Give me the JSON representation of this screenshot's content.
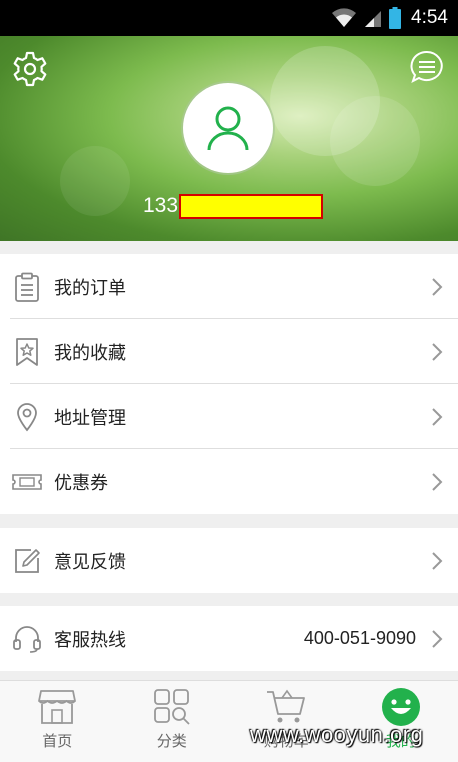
{
  "status_bar": {
    "time": "4:54"
  },
  "profile": {
    "phone_prefix": "133"
  },
  "menu": {
    "orders": "我的订单",
    "favorites": "我的收藏",
    "address": "地址管理",
    "coupons": "优惠券",
    "feedback": "意见反馈",
    "hotline": "客服热线",
    "hotline_number": "400-051-9090"
  },
  "tabs": [
    {
      "label": "首页",
      "icon": "store-icon"
    },
    {
      "label": "分类",
      "icon": "category-icon"
    },
    {
      "label": "购物车",
      "icon": "cart-icon"
    },
    {
      "label": "我的",
      "icon": "smiley-icon",
      "active": true
    }
  ],
  "watermark": "www.wooyun.org",
  "colors": {
    "accent": "#22b14c",
    "header_green": "#7dbb4e",
    "redaction_fill": "#ffff00",
    "redaction_border": "#d40000"
  }
}
